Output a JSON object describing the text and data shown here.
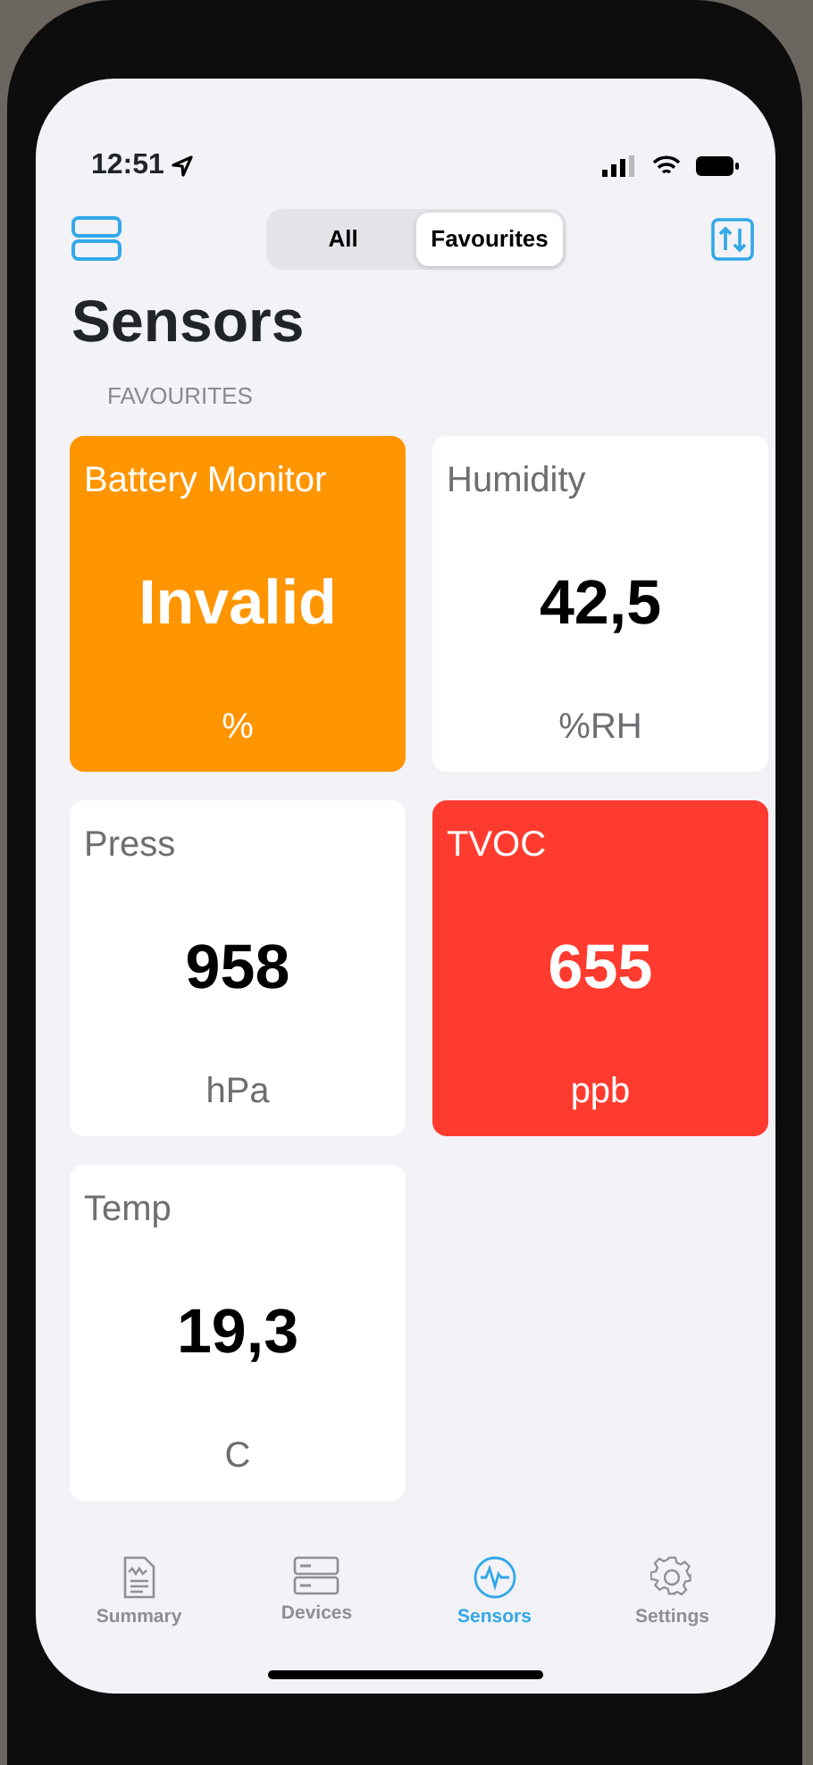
{
  "status_bar": {
    "time": "12:51"
  },
  "segments": [
    {
      "label": "All",
      "selected": false
    },
    {
      "label": "Favourites",
      "selected": true
    }
  ],
  "title": "Sensors",
  "section": "FAVOURITES",
  "tiles": [
    {
      "name": "Battery Monitor",
      "value": "Invalid",
      "unit": "%",
      "color": "#ff9500"
    },
    {
      "name": "Humidity",
      "value": "42,5",
      "unit": "%RH",
      "color": "#ffffff"
    },
    {
      "name": "Press",
      "value": "958",
      "unit": "hPa",
      "color": "#ffffff"
    },
    {
      "name": "TVOC",
      "value": "655",
      "unit": "ppb",
      "color": "#ff3b30"
    },
    {
      "name": "Temp",
      "value": "19,3",
      "unit": "C",
      "color": "#ffffff"
    }
  ],
  "tab_bar": [
    {
      "label": "Summary",
      "kind": "document",
      "selected": false
    },
    {
      "label": "Devices",
      "kind": "server",
      "selected": false
    },
    {
      "label": "Sensors",
      "kind": "pulse",
      "selected": true
    },
    {
      "label": "Settings",
      "kind": "gear",
      "selected": false
    }
  ]
}
